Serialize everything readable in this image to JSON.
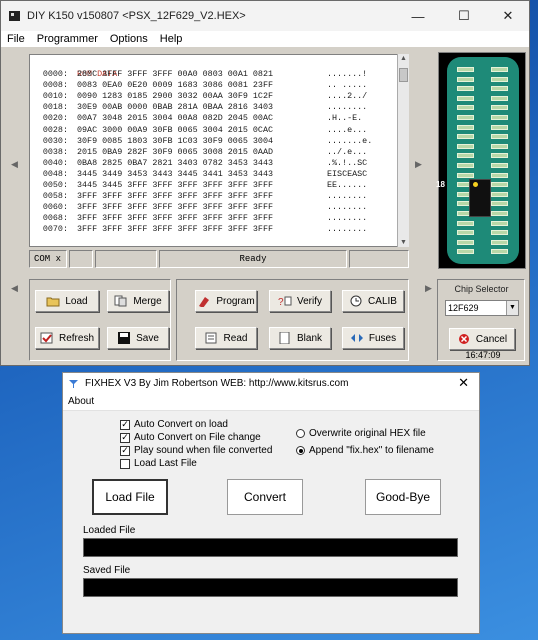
{
  "k150": {
    "title": "DIY K150 v150807 <PSX_12F629_V2.HEX>",
    "menu": [
      "File",
      "Programmer",
      "Options",
      "Help"
    ],
    "hex_header": "ROM DATA",
    "rows": [
      {
        "addr": "0000:",
        "data": "280C 3FFF 3FFF 3FFF 00A0 0803 00A1 0821",
        "ascii": ".......!"
      },
      {
        "addr": "0008:",
        "data": "0083 0EA0 0E20 0009 1683 3086 0081 23FF",
        "ascii": ".. ....."
      },
      {
        "addr": "0010:",
        "data": "0090 1283 0185 2900 3032 00AA 30F9 1C2F",
        "ascii": "....2../"
      },
      {
        "addr": "0018:",
        "data": "30E9 00AB 0000 0BAB 281A 0BAA 2816 3403",
        "ascii": "........"
      },
      {
        "addr": "0020:",
        "data": "00A7 3048 2015 3004 00A8 082D 2045 00AC",
        "ascii": ".H..-E."
      },
      {
        "addr": "0028:",
        "data": "09AC 3000 00A9 30FB 0065 3004 2015 0CAC",
        "ascii": "....e..."
      },
      {
        "addr": "0030:",
        "data": "30F9 0085 1803 30FB 1C03 30F9 0065 3004",
        "ascii": ".......e."
      },
      {
        "addr": "0038:",
        "data": "2015 0BA9 282F 30F9 0065 3008 2015 0AAD",
        "ascii": "../.e..."
      },
      {
        "addr": "0040:",
        "data": "0BA8 2825 0BA7 2821 3403 0782 3453 3443",
        "ascii": ".%.!..SC"
      },
      {
        "addr": "0048:",
        "data": "3445 3449 3453 3443 3445 3441 3453 3443",
        "ascii": "EISCEASC"
      },
      {
        "addr": "0050:",
        "data": "3445 3445 3FFF 3FFF 3FFF 3FFF 3FFF 3FFF",
        "ascii": "EE......"
      },
      {
        "addr": "0058:",
        "data": "3FFF 3FFF 3FFF 3FFF 3FFF 3FFF 3FFF 3FFF",
        "ascii": "........"
      },
      {
        "addr": "0060:",
        "data": "3FFF 3FFF 3FFF 3FFF 3FFF 3FFF 3FFF 3FFF",
        "ascii": "........"
      },
      {
        "addr": "0068:",
        "data": "3FFF 3FFF 3FFF 3FFF 3FFF 3FFF 3FFF 3FFF",
        "ascii": "........"
      },
      {
        "addr": "0070:",
        "data": "3FFF 3FFF 3FFF 3FFF 3FFF 3FFF 3FFF 3FFF",
        "ascii": "........"
      }
    ],
    "status": {
      "port": "COM",
      "port_x": "x",
      "state": "Ready"
    },
    "buttons": {
      "load": "Load",
      "merge": "Merge",
      "refresh": "Refresh",
      "save": "Save",
      "program": "Program",
      "verify": "Verify",
      "calib": "CALIB",
      "read": "Read",
      "blank": "Blank",
      "fuses": "Fuses",
      "cancel": "Cancel"
    },
    "chip_selector_label": "Chip Selector",
    "chip_selected": "12F629",
    "clock": "16:47:09",
    "pin_marker": "18"
  },
  "fixhex": {
    "title": "FIXHEX V3 By Jim Robertson  WEB: http://www.kitsrus.com",
    "menu": "About",
    "options": [
      {
        "label": "Auto Convert on load",
        "checked": true
      },
      {
        "label": "Auto Convert on File change",
        "checked": true
      },
      {
        "label": "Play sound when file converted",
        "checked": true
      },
      {
        "label": "Load Last File",
        "checked": false
      }
    ],
    "radios": [
      {
        "label": "Overwrite original HEX file",
        "selected": false
      },
      {
        "label": "Append \"fix.hex\" to filename",
        "selected": true
      }
    ],
    "buttons": {
      "load": "Load File",
      "convert": "Convert",
      "goodbye": "Good-Bye"
    },
    "loaded_label": "Loaded File",
    "saved_label": "Saved File"
  }
}
